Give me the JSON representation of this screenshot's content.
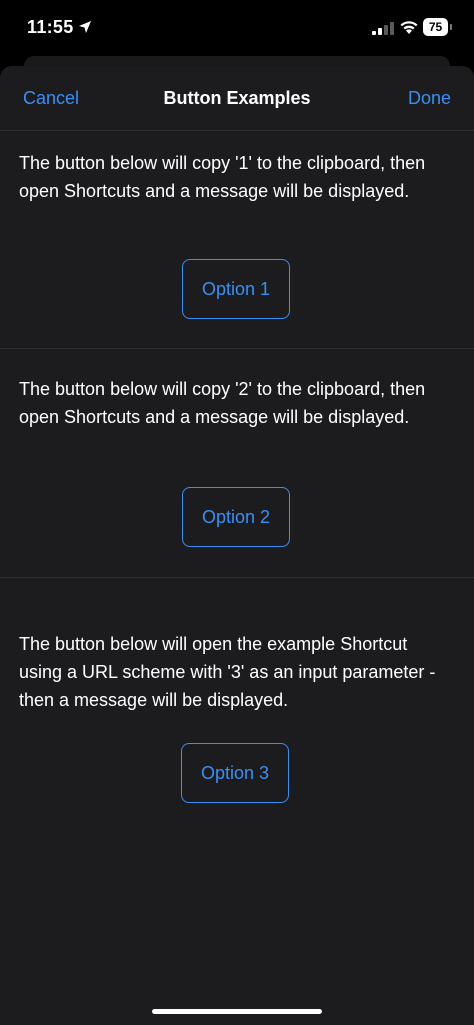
{
  "status_bar": {
    "time": "11:55",
    "battery": "75",
    "icons": [
      "location-arrow-icon",
      "cellular-signal-icon",
      "wifi-icon",
      "battery-icon"
    ]
  },
  "nav": {
    "cancel_label": "Cancel",
    "title": "Button Examples",
    "done_label": "Done"
  },
  "sections": [
    {
      "text": "The button below will copy '1' to the clipboard, then open Shortcuts and a message will be displayed.",
      "button_label": "Option 1"
    },
    {
      "text": "The button below will copy '2' to the clipboard, then open Shortcuts and a message will be displayed.",
      "button_label": "Option 2"
    },
    {
      "text": "The button below will open the example Shortcut using a URL scheme with '3' as an input parameter - then a message will be displayed.",
      "button_label": "Option 3"
    }
  ],
  "colors": {
    "accent": "#3a8ff7",
    "sheet_background": "#1c1c1e",
    "separator": "#2e2e30",
    "text": "#ffffff"
  }
}
